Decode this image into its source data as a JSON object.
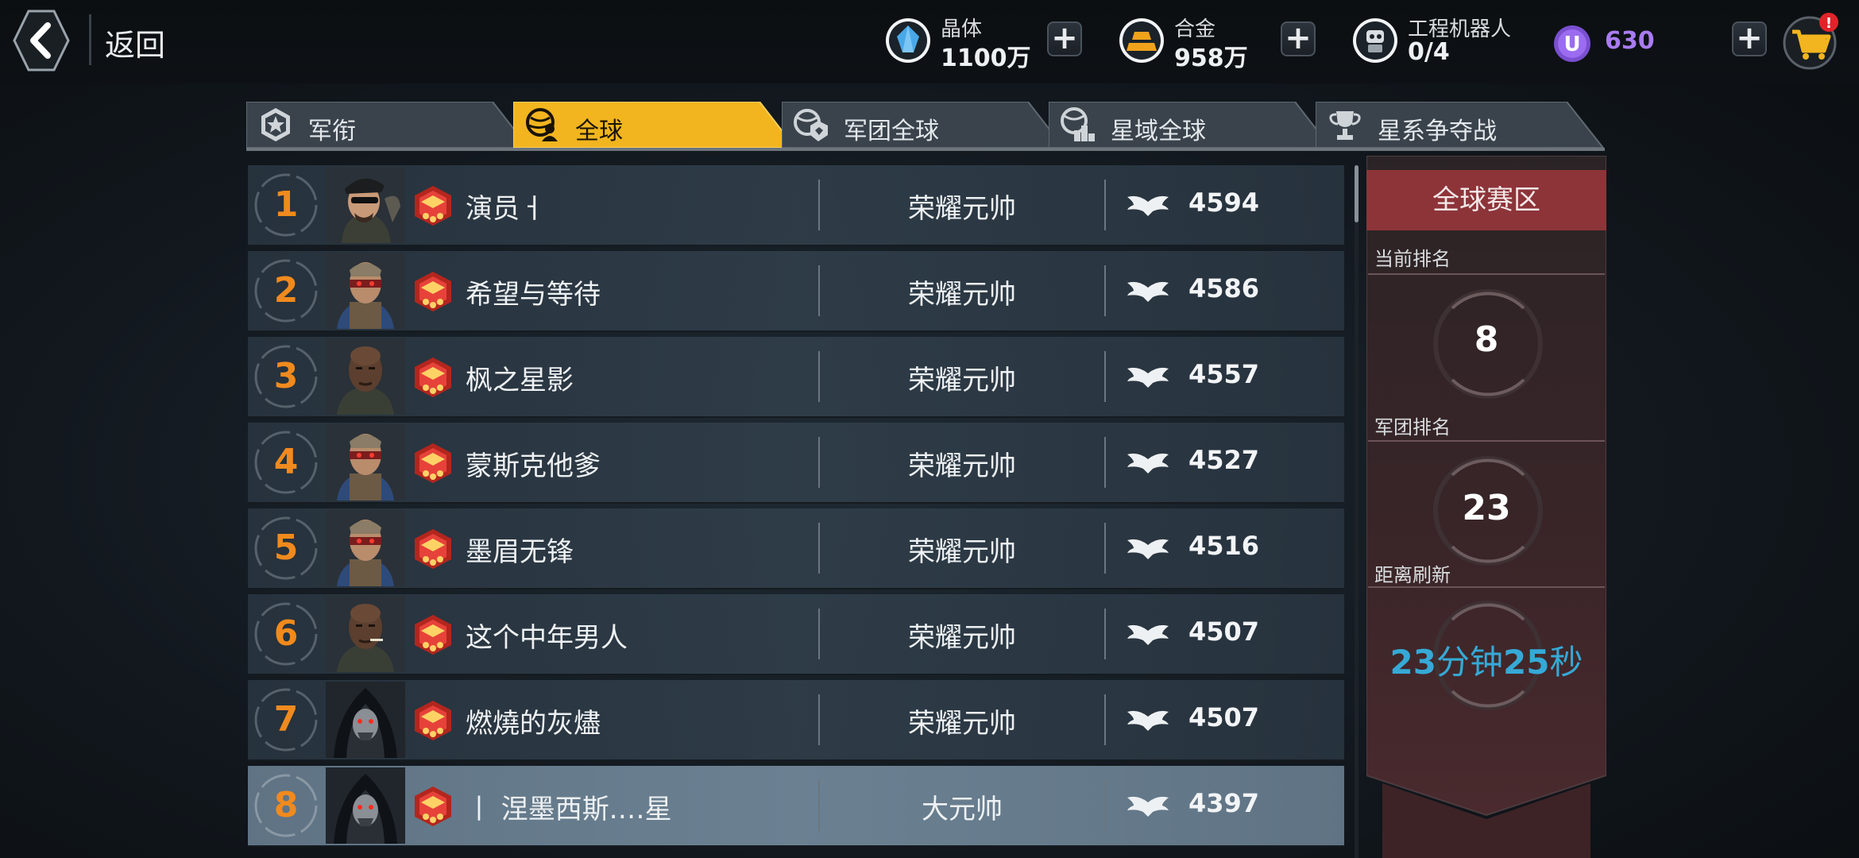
{
  "header": {
    "back_label": "返回",
    "resources": [
      {
        "name": "晶体",
        "value": "1100万",
        "icon": "crystal-icon",
        "color": "#49a8e8"
      },
      {
        "name": "合金",
        "value": "958万",
        "icon": "alloy-icon",
        "color": "#f0a21c"
      },
      {
        "name": "工程机器人",
        "value": "0/4",
        "icon": "robot-icon",
        "color": "#d9dde1"
      }
    ],
    "u_currency": {
      "symbol": "U",
      "value": "630",
      "color": "#a97cf0"
    },
    "plus_label": "+",
    "cart_badge": "!"
  },
  "tabs": [
    {
      "label": "军衔",
      "icon": "rank-star-icon",
      "active": false
    },
    {
      "label": "全球",
      "icon": "global-players-icon",
      "active": true
    },
    {
      "label": "军团全球",
      "icon": "legion-globe-icon",
      "active": false
    },
    {
      "label": "星域全球",
      "icon": "podium-globe-icon",
      "active": false
    },
    {
      "label": "星系争夺战",
      "icon": "trophy-icon",
      "active": false
    }
  ],
  "rankings": [
    {
      "rank": "1",
      "name": "演员ㅓ",
      "title": "荣耀元帅",
      "score": "4594",
      "avatar": "officer-beret-avatar"
    },
    {
      "rank": "2",
      "name": "希望与等待",
      "title": "荣耀元帅",
      "score": "4586",
      "avatar": "cyborg-visor-avatar"
    },
    {
      "rank": "3",
      "name": "枫之星影",
      "title": "荣耀元帅",
      "score": "4557",
      "avatar": "soldier-bald-avatar"
    },
    {
      "rank": "4",
      "name": "蒙斯克他爹",
      "title": "荣耀元帅",
      "score": "4527",
      "avatar": "cyborg-visor-avatar"
    },
    {
      "rank": "5",
      "name": "墨眉无锋",
      "title": "荣耀元帅",
      "score": "4516",
      "avatar": "cyborg-visor-avatar"
    },
    {
      "rank": "6",
      "name": "这个中年男人",
      "title": "荣耀元帅",
      "score": "4507",
      "avatar": "soldier-bald-avatar"
    },
    {
      "rank": "7",
      "name": "燃燒的灰燼",
      "title": "荣耀元帅",
      "score": "4507",
      "avatar": "hooded-red-eyes-avatar"
    },
    {
      "rank": "8",
      "name": "丨 涅墨西斯.…星",
      "title": "大元帅",
      "score": "4397",
      "avatar": "hooded-red-eyes-avatar",
      "is_me": true
    }
  ],
  "panel": {
    "title": "全球赛区",
    "current_rank_label": "当前排名",
    "current_rank": "8",
    "legion_rank_label": "军团排名",
    "legion_rank": "23",
    "refresh_label": "距离刷新",
    "timer": {
      "minutes": "23",
      "min_unit": "分钟",
      "seconds": "25",
      "sec_unit": "秒"
    }
  },
  "colors": {
    "accent_tab": "#f2b51f",
    "rank_number": "#f08a1e",
    "panel_red": "#8d3439",
    "timer": "#36a9d6"
  }
}
